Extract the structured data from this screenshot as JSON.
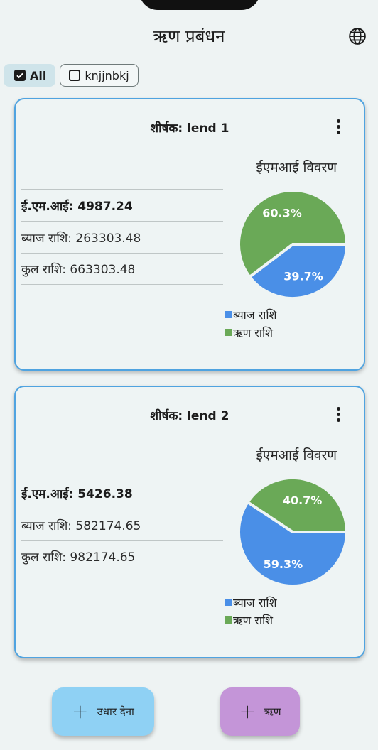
{
  "app": {
    "title": "ऋण प्रबंधन",
    "language_icon": "globe-icon"
  },
  "filters": [
    {
      "label": "All",
      "checked": true
    },
    {
      "label": "knjjnbkj",
      "checked": false
    }
  ],
  "colors": {
    "interest": "#4a8fe7",
    "principal": "#6aa957",
    "card_border": "#4fa3e0",
    "lend_fab": "#8fd1f4",
    "loan_fab": "#c495d8"
  },
  "cards": [
    {
      "title": "शीर्षक: lend 1",
      "emi": "ई.एम.आई: 4987.24",
      "interest": "ब्याज राशि: 263303.48",
      "total": "कुल राशि: 663303.48",
      "chart_title": "ईएमआई विवरण",
      "interest_pct_label": "39.7%",
      "principal_pct_label": "60.3%",
      "legend_interest": "ब्याज राशि",
      "legend_principal": "ऋण राशि"
    },
    {
      "title": "शीर्षक: lend 2",
      "emi": "ई.एम.आई: 5426.38",
      "interest": "ब्याज राशि: 582174.65",
      "total": "कुल राशि: 982174.65",
      "chart_title": "ईएमआई विवरण",
      "interest_pct_label": "59.3%",
      "principal_pct_label": "40.7%",
      "legend_interest": "ब्याज राशि",
      "legend_principal": "ऋण राशि"
    }
  ],
  "chart_data": [
    {
      "type": "pie",
      "title": "ईएमआई विवरण",
      "labels": [
        "ब्याज राशि",
        "ऋण राशि"
      ],
      "values": [
        39.7,
        60.3
      ]
    },
    {
      "type": "pie",
      "title": "ईएमआई विवरण",
      "labels": [
        "ब्याज राशि",
        "ऋण राशि"
      ],
      "values": [
        59.3,
        40.7
      ]
    }
  ],
  "actions": {
    "lend_label": "उधार देना",
    "loan_label": "ऋण"
  }
}
